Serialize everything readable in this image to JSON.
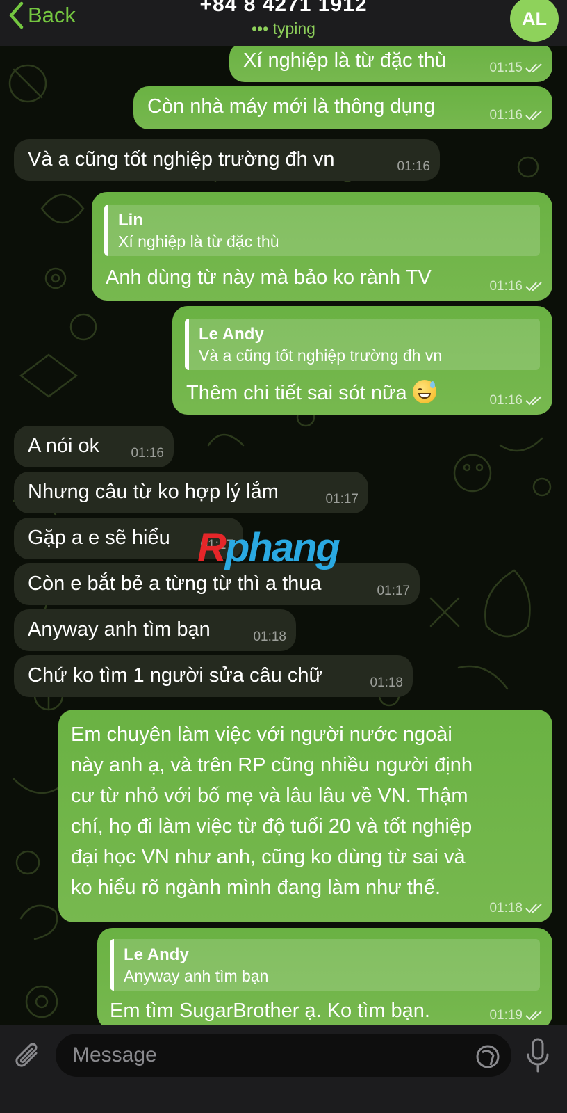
{
  "header": {
    "back_label": "Back",
    "contact": "+84 8 4271 1912",
    "status": "••• typing",
    "avatar_initials": "AL"
  },
  "messages": [
    {
      "dir": "out",
      "text": "Xí nghiệp là từ đặc thù",
      "time": "01:15"
    },
    {
      "dir": "out",
      "text": "Còn nhà máy mới là thông dụng",
      "time": "01:16"
    },
    {
      "dir": "in",
      "text": "Và a cũng tốt nghiệp trường đh vn",
      "time": "01:16"
    },
    {
      "dir": "out",
      "reply_name": "Lin",
      "reply_text": "Xí nghiệp là từ đặc thù",
      "text": "Anh dùng từ này mà bảo ko rành TV",
      "time": "01:16"
    },
    {
      "dir": "out",
      "reply_name": "Le Andy",
      "reply_text": "Và a cũng tốt nghiệp trường đh vn",
      "text": "Thêm chi tiết sai sót nữa",
      "emoji": "grinning-sweat-emoji",
      "time": "01:16"
    },
    {
      "dir": "in",
      "text": "A nói ok",
      "time": "01:16"
    },
    {
      "dir": "in",
      "text": "Nhưng câu từ ko hợp lý lắm",
      "time": "01:17"
    },
    {
      "dir": "in",
      "text": "Gặp a e sẽ hiểu",
      "time": "01:17"
    },
    {
      "dir": "in",
      "text": "Còn e bắt bẻ a từng từ thì a thua",
      "time": "01:17"
    },
    {
      "dir": "in",
      "text": "Anyway anh tìm bạn",
      "time": "01:18"
    },
    {
      "dir": "in",
      "text": "Chứ ko tìm 1 người sửa câu chữ",
      "time": "01:18"
    },
    {
      "dir": "out",
      "lines": [
        "Em chuyên làm việc với người nước ngoài",
        "này anh ạ, và trên RP cũng nhiều người định",
        "cư từ nhỏ với bố mẹ và lâu lâu về VN. Thậm",
        "chí, họ đi làm việc từ độ tuổi 20 và tốt nghiệp",
        "đại học VN như anh, cũng ko dùng từ sai và",
        "ko hiểu rõ ngành mình đang làm như thế."
      ],
      "time": "01:18"
    },
    {
      "dir": "out",
      "reply_name": "Le Andy",
      "reply_text": "Anyway anh tìm bạn",
      "text": "Em tìm SugarBrother ạ. Ko tìm bạn.",
      "time": "01:19"
    }
  ],
  "watermark": {
    "first": "R",
    "rest": "phang"
  },
  "input": {
    "placeholder": "Message"
  },
  "icons": {
    "back": "chevron-left-icon",
    "attach": "paperclip-icon",
    "sticker": "sticker-icon",
    "mic": "microphone-icon",
    "read": "double-check-icon"
  },
  "colors": {
    "outgoing_bubble": "#6ab243",
    "incoming_bubble": "#252a1f",
    "accent": "#74c640",
    "header_bg": "#1c1c1e"
  }
}
